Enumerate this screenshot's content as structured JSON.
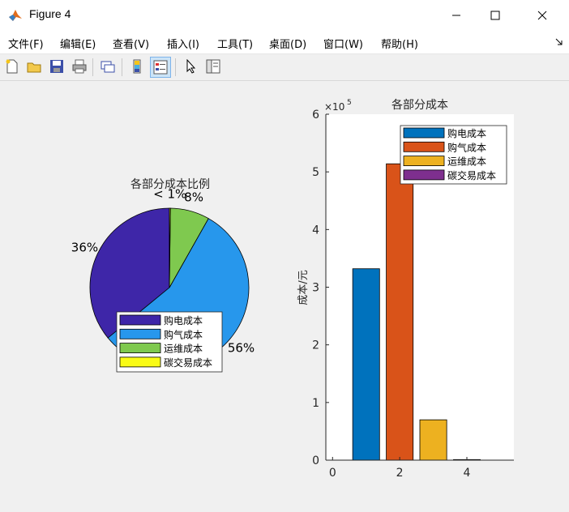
{
  "window": {
    "title": "Figure 4",
    "icon": "matlab-icon"
  },
  "menu": [
    "文件(F)",
    "编辑(E)",
    "查看(V)",
    "插入(I)",
    "工具(T)",
    "桌面(D)",
    "窗口(W)",
    "帮助(H)"
  ],
  "toolbar": [
    "new-figure-icon",
    "open-icon",
    "save-icon",
    "print-icon",
    "link-plot-icon",
    "colorbar-icon",
    "legend-icon",
    "pointer-icon",
    "property-inspector-icon"
  ],
  "chart_data": [
    {
      "type": "pie",
      "title": "各部分成本比例",
      "labels": [
        "购电成本",
        "购气成本",
        "运维成本",
        "碳交易成本"
      ],
      "values": [
        36,
        56,
        8,
        0.2
      ],
      "slice_labels": [
        "36%",
        "56%",
        "8%",
        "< 1%"
      ],
      "colors": [
        "#3e26a8",
        "#2797ec",
        "#7fc94f",
        "#f9fb15"
      ],
      "legend_position": "bottom-right"
    },
    {
      "type": "bar",
      "title": "各部分成本",
      "ylabel": "成本/元",
      "xlabel": "",
      "x": [
        1,
        2,
        3,
        4
      ],
      "values": [
        332000,
        514000,
        70000,
        1000
      ],
      "ylim": [
        0,
        600000
      ],
      "xlim": [
        -0.2,
        5.4
      ],
      "xticks": [
        "0",
        "2",
        "4"
      ],
      "yticks": [
        "0",
        "1",
        "2",
        "3",
        "4",
        "5",
        "6"
      ],
      "exponent": "×10",
      "exponent_power": "5",
      "labels": [
        "购电成本",
        "购气成本",
        "运维成本",
        "碳交易成本"
      ],
      "colors": [
        "#0072bd",
        "#d95319",
        "#edb120",
        "#7e2f8e"
      ],
      "legend_position": "top-right"
    }
  ]
}
